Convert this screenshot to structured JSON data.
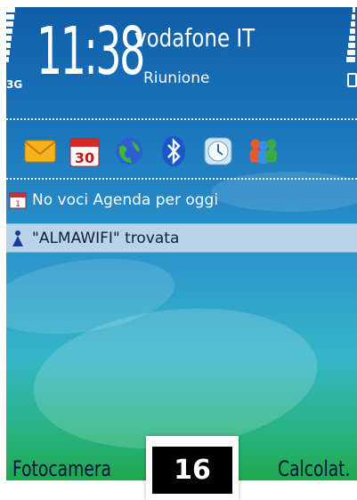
{
  "status": {
    "network": "3G",
    "time": "11:38",
    "operator": "vodafone IT",
    "profile": "Riunione"
  },
  "shortcuts": [
    {
      "name": "messaging-icon"
    },
    {
      "name": "calendar-icon",
      "label": "30"
    },
    {
      "name": "web-icon"
    },
    {
      "name": "bluetooth-icon"
    },
    {
      "name": "clock-icon"
    },
    {
      "name": "contacts-icon"
    }
  ],
  "notifications": [
    {
      "icon": "calendar-icon",
      "text": "No voci Agenda per oggi"
    },
    {
      "icon": "wifi-user-icon",
      "text": "\"ALMAWIFI\" trovata"
    }
  ],
  "softkeys": {
    "left": "Fotocamera",
    "right": "Calcolat."
  },
  "badge": "16"
}
